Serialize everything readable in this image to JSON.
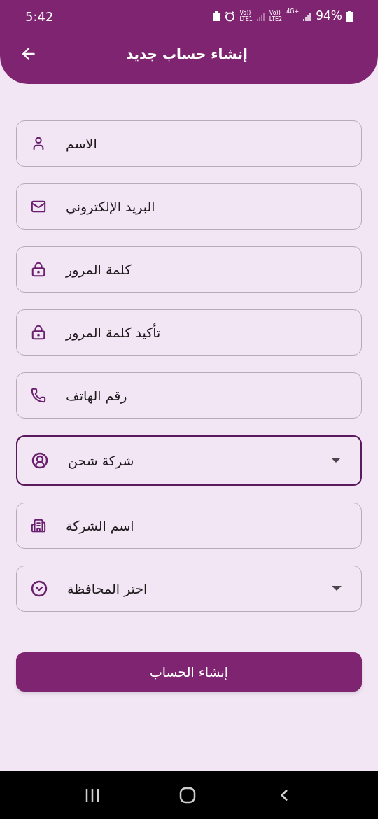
{
  "status_bar": {
    "time": "5:42",
    "sim1_volte": "Vo))",
    "sim1": "LTE1",
    "sim2_volte": "Vo))",
    "sim2": "LTE2",
    "network": "4G+",
    "battery": "94%"
  },
  "app_bar": {
    "title": "إنشاء حساب جديد"
  },
  "fields": [
    {
      "kind": "text",
      "placeholder": "الاسم",
      "focused": false
    },
    {
      "kind": "text",
      "placeholder": "البريد الإلكتروني",
      "focused": false
    },
    {
      "kind": "text",
      "placeholder": "كلمة المرور",
      "focused": false
    },
    {
      "kind": "text",
      "placeholder": "تأكيد كلمة المرور",
      "focused": false
    },
    {
      "kind": "text",
      "placeholder": "رقم الهاتف",
      "focused": false
    },
    {
      "kind": "dropdown",
      "value": "شركة شحن",
      "focused": true
    },
    {
      "kind": "text",
      "placeholder": "اسم الشركة",
      "focused": false
    },
    {
      "kind": "dropdown",
      "value": "اختر المحافظة",
      "focused": false
    }
  ],
  "submit_button": {
    "label": "إنشاء الحساب"
  }
}
